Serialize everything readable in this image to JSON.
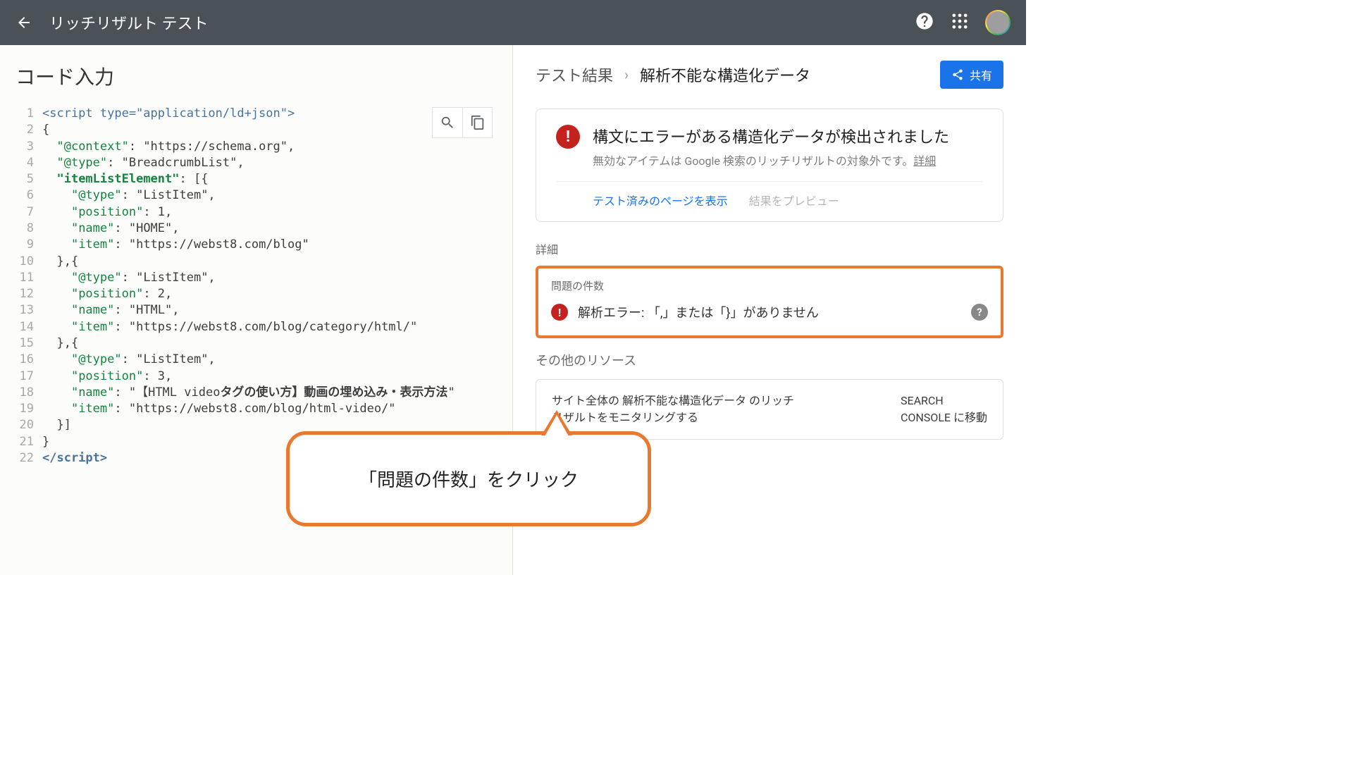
{
  "header": {
    "title": "リッチリザルト テスト"
  },
  "left": {
    "title": "コード入力",
    "code_lines": [
      {
        "n": "1",
        "html": "<span class='tag'>&lt;script type=\"application/ld+json\"&gt;</span>"
      },
      {
        "n": "2",
        "html": "{"
      },
      {
        "n": "3",
        "html": "  <span class='key'>\"@context\"</span>: \"https://schema.org\","
      },
      {
        "n": "4",
        "html": "  <span class='key'>\"@type\"</span>: \"BreadcrumbList\","
      },
      {
        "n": "5",
        "html": "  <span class='key'><b>\"itemListElement\"</b></span>: [{"
      },
      {
        "n": "6",
        "html": "    <span class='key'>\"@type\"</span>: \"ListItem\","
      },
      {
        "n": "7",
        "html": "    <span class='key'>\"position\"</span>: 1,"
      },
      {
        "n": "8",
        "html": "    <span class='key'>\"name\"</span>: \"HOME\","
      },
      {
        "n": "9",
        "html": "    <span class='key'>\"item\"</span>: \"https://webst8.com/blog\""
      },
      {
        "n": "10",
        "html": "  },{"
      },
      {
        "n": "11",
        "html": "    <span class='key'>\"@type\"</span>: \"ListItem\","
      },
      {
        "n": "12",
        "html": "    <span class='key'>\"position\"</span>: 2,"
      },
      {
        "n": "13",
        "html": "    <span class='key'>\"name\"</span>: \"HTML\","
      },
      {
        "n": "14",
        "html": "    <span class='key'>\"item\"</span>: \"https://webst8.com/blog/category/html/\""
      },
      {
        "n": "15",
        "html": "  },{"
      },
      {
        "n": "16",
        "html": "    <span class='key'>\"@type\"</span>: \"ListItem\","
      },
      {
        "n": "17",
        "html": "    <span class='key'>\"position\"</span>: 3,"
      },
      {
        "n": "18",
        "html": "    <span class='key'>\"name\"</span>: \"【HTML video<b>タグの使い方】動画の埋め込み・表示方法</b>\""
      },
      {
        "n": "19",
        "html": "    <span class='key'>\"item\"</span>: \"https://webst8.com/blog/html-video/\""
      },
      {
        "n": "20",
        "html": "  }]"
      },
      {
        "n": "21",
        "html": "}"
      },
      {
        "n": "22",
        "html": "<span class='tag'><b>&lt;/script&gt;</b></span>"
      }
    ]
  },
  "right": {
    "breadcrumb_root": "テスト結果",
    "breadcrumb_current": "解析不能な構造化データ",
    "share_label": "共有",
    "card": {
      "title": "構文にエラーがある構造化データが検出されました",
      "subtitle_prefix": "無効なアイテムは Google 検索のリッチリザルトの対象外です。",
      "subtitle_link": "詳細",
      "action_view": "テスト済みのページを表示",
      "action_preview": "結果をプレビュー"
    },
    "details_heading": "詳細",
    "issues_title": "問題の件数",
    "issue_text": "解析エラー: 「,」または「}」がありません",
    "other_heading": "その他のリソース",
    "monitor_left": "サイト全体の 解析不能な構造化データ のリッチ\nリザルトをモニタリングする",
    "monitor_right": "SEARCH\nCONSOLE に移動",
    "callout_text": "「問題の件数」をクリック"
  }
}
